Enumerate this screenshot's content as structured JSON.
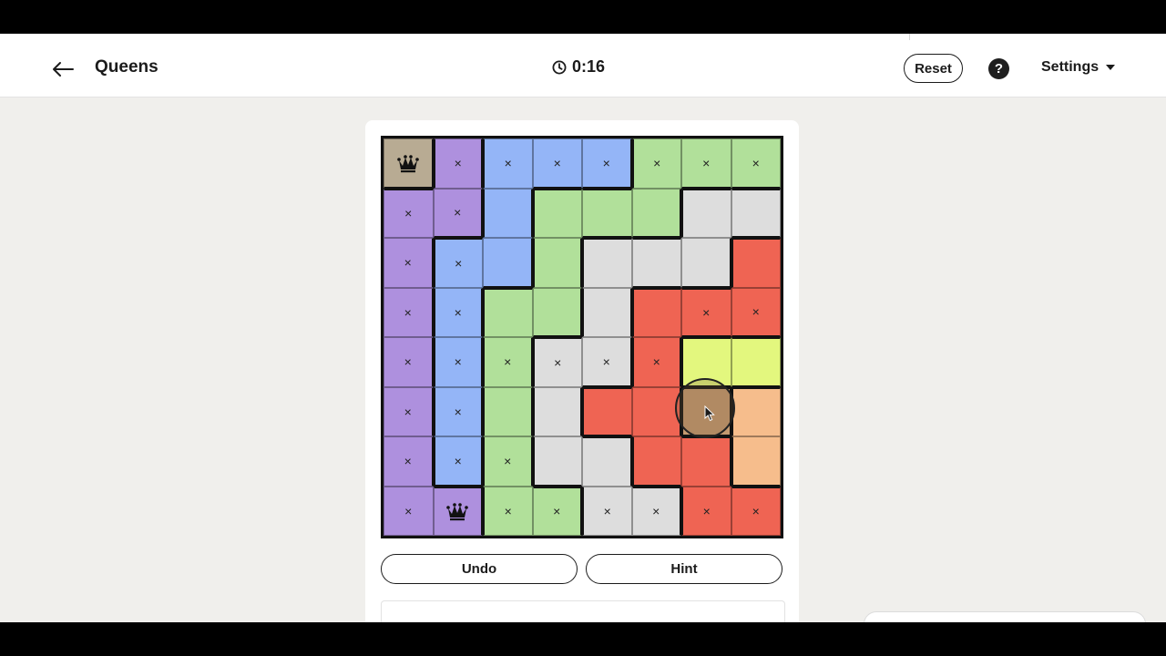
{
  "header": {
    "title": "Queens",
    "timer": "0:16",
    "reset_label": "Reset",
    "help_label": "?",
    "settings_label": "Settings"
  },
  "board": {
    "size": 8,
    "region_colors": {
      "tan": "#b8ab93",
      "purple": "#ae90de",
      "blue": "#94b5f7",
      "green": "#b1e09a",
      "gray": "#dddddd",
      "red": "#ef6453",
      "yellow": "#e3f77e",
      "orange": "#f6bd8c",
      "brown": "#c49a70"
    },
    "rows": [
      [
        "tan",
        "purple",
        "blue",
        "blue",
        "blue",
        "green",
        "green",
        "green"
      ],
      [
        "purple",
        "purple",
        "blue",
        "green",
        "green",
        "green",
        "gray",
        "gray"
      ],
      [
        "purple",
        "blue",
        "blue",
        "green",
        "gray",
        "gray",
        "gray",
        "red"
      ],
      [
        "purple",
        "blue",
        "green",
        "green",
        "gray",
        "red",
        "red",
        "red"
      ],
      [
        "purple",
        "blue",
        "green",
        "gray",
        "gray",
        "red",
        "yellow",
        "yellow"
      ],
      [
        "purple",
        "blue",
        "green",
        "gray",
        "red",
        "red",
        "brown",
        "orange"
      ],
      [
        "purple",
        "blue",
        "green",
        "gray",
        "gray",
        "red",
        "red",
        "orange"
      ],
      [
        "purple",
        "purple",
        "green",
        "green",
        "gray",
        "gray",
        "red",
        "red"
      ]
    ],
    "marks": [
      [
        "Q",
        "x",
        "x",
        "x",
        "x",
        "x",
        "x",
        "x"
      ],
      [
        "x",
        "x",
        "",
        "",
        "",
        "",
        "",
        ""
      ],
      [
        "x",
        "x",
        "",
        "",
        "",
        "",
        "",
        ""
      ],
      [
        "x",
        "x",
        "",
        "",
        "",
        "",
        "x",
        "x"
      ],
      [
        "x",
        "x",
        "x",
        "x",
        "x",
        "x",
        "",
        ""
      ],
      [
        "x",
        "x",
        "",
        "",
        "",
        "",
        "",
        ""
      ],
      [
        "x",
        "x",
        "x",
        "",
        "",
        "",
        "",
        ""
      ],
      [
        "x",
        "Q",
        "x",
        "x",
        "x",
        "x",
        "x",
        "x"
      ]
    ]
  },
  "actions": {
    "undo_label": "Undo",
    "hint_label": "Hint"
  }
}
